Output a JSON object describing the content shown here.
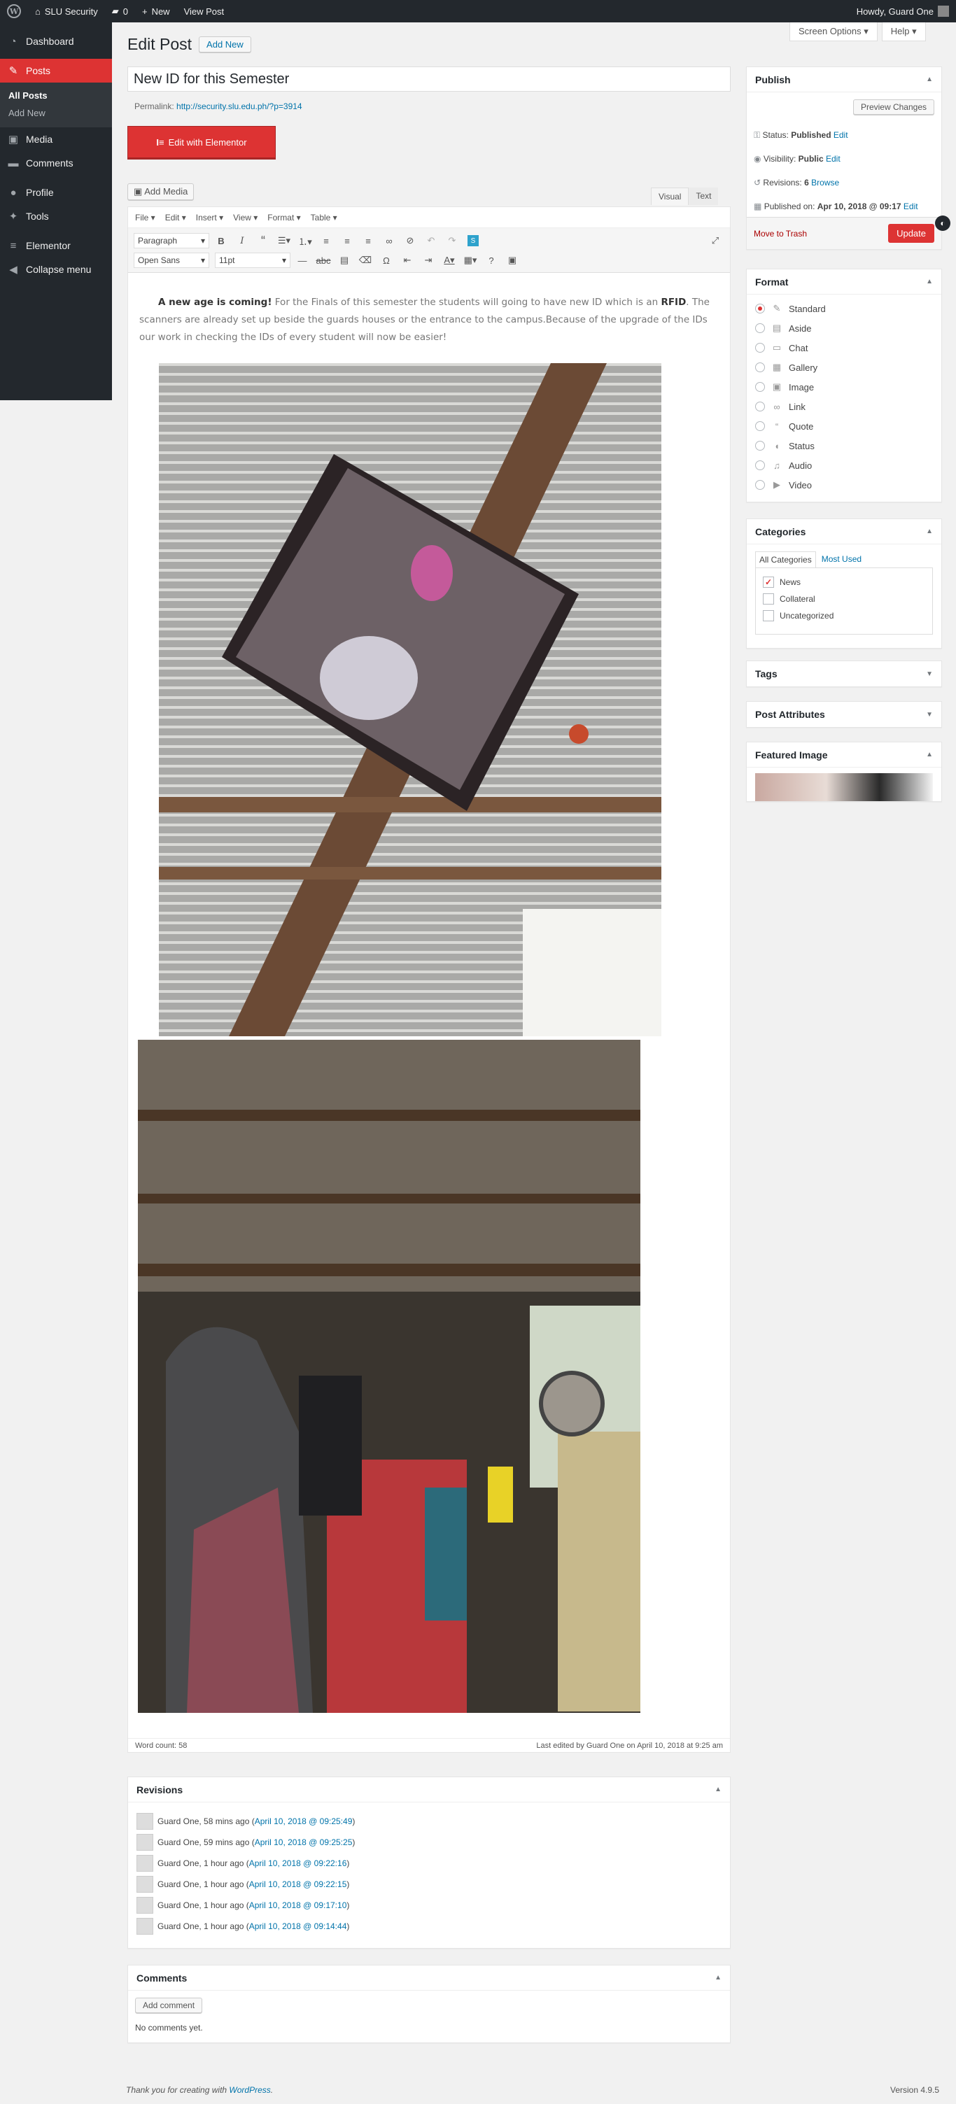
{
  "adminbar": {
    "site_name": "SLU Security",
    "comments_count": "0",
    "new_label": "New",
    "view_post": "View Post",
    "howdy": "Howdy, Guard One"
  },
  "sidebar": {
    "dashboard": "Dashboard",
    "posts": "Posts",
    "all_posts": "All Posts",
    "add_new": "Add New",
    "media": "Media",
    "comments": "Comments",
    "profile": "Profile",
    "tools": "Tools",
    "elementor": "Elementor",
    "collapse": "Collapse menu"
  },
  "header": {
    "title": "Edit Post",
    "add_new": "Add New",
    "screen_options": "Screen Options",
    "help": "Help"
  },
  "post": {
    "title_value": "New ID for this Semester",
    "permalink_label": "Permalink:",
    "permalink_url": "http://security.slu.edu.ph/?p=3914",
    "elementor_button": "Edit with Elementor",
    "add_media": "Add Media",
    "tab_visual": "Visual",
    "tab_text": "Text"
  },
  "editor": {
    "menus": [
      "File",
      "Edit",
      "Insert",
      "View",
      "Format",
      "Table"
    ],
    "paragraph_select": "Paragraph",
    "font_select": "Open Sans",
    "size_select": "11pt",
    "content_bold": "A new age is coming!",
    "content_text1": " For the Finals of this semester the students will going to have new ID which is an ",
    "content_rfid": "RFID",
    "content_text2": ".  The scanners are already set up beside the guards houses or the entrance to the campus.Because of the upgrade of the IDs our work in checking the IDs of every student will now be easier!",
    "word_count": "Word count: 58",
    "last_edited": "Last edited by Guard One on April 10, 2018 at 9:25 am"
  },
  "publish": {
    "heading": "Publish",
    "preview": "Preview Changes",
    "status_label": "Status:",
    "status_value": "Published",
    "visibility_label": "Visibility:",
    "visibility_value": "Public",
    "revisions_label": "Revisions:",
    "revisions_value": "6",
    "browse": "Browse",
    "published_label": "Published on:",
    "published_value": "Apr 10, 2018 @ 09:17",
    "edit": "Edit",
    "trash": "Move to Trash",
    "update": "Update"
  },
  "format": {
    "heading": "Format",
    "options": [
      {
        "label": "Standard",
        "icon": "pin-icon"
      },
      {
        "label": "Aside",
        "icon": "aside-icon"
      },
      {
        "label": "Chat",
        "icon": "chat-icon"
      },
      {
        "label": "Gallery",
        "icon": "gallery-icon"
      },
      {
        "label": "Image",
        "icon": "image-icon"
      },
      {
        "label": "Link",
        "icon": "link-icon"
      },
      {
        "label": "Quote",
        "icon": "quote-icon"
      },
      {
        "label": "Status",
        "icon": "status-icon"
      },
      {
        "label": "Audio",
        "icon": "audio-icon"
      },
      {
        "label": "Video",
        "icon": "video-icon"
      }
    ],
    "selected": "Standard"
  },
  "categories": {
    "heading": "Categories",
    "tab_all": "All Categories",
    "tab_used": "Most Used",
    "items": [
      {
        "label": "News",
        "checked": true
      },
      {
        "label": "Collateral",
        "checked": false
      },
      {
        "label": "Uncategorized",
        "checked": false
      }
    ]
  },
  "tags": {
    "heading": "Tags"
  },
  "attributes": {
    "heading": "Post Attributes"
  },
  "featured": {
    "heading": "Featured Image"
  },
  "revisions": {
    "heading": "Revisions",
    "items": [
      {
        "who": "Guard One, 58 mins ago (",
        "link": "April 10, 2018 @ 09:25:49",
        "end": ")"
      },
      {
        "who": "Guard One, 59 mins ago (",
        "link": "April 10, 2018 @ 09:25:25",
        "end": ")"
      },
      {
        "who": "Guard One, 1 hour ago (",
        "link": "April 10, 2018 @ 09:22:16",
        "end": ")"
      },
      {
        "who": "Guard One, 1 hour ago (",
        "link": "April 10, 2018 @ 09:22:15",
        "end": ")"
      },
      {
        "who": "Guard One, 1 hour ago (",
        "link": "April 10, 2018 @ 09:17:10",
        "end": ")"
      },
      {
        "who": "Guard One, 1 hour ago (",
        "link": "April 10, 2018 @ 09:14:44",
        "end": ")"
      }
    ]
  },
  "comments_box": {
    "heading": "Comments",
    "add": "Add comment",
    "none": "No comments yet."
  },
  "footer": {
    "thanks": "Thank you for creating with ",
    "wp": "WordPress",
    "thanks_end": ".",
    "version": "Version 4.9.5"
  },
  "colors": {
    "accent": "#dd3333",
    "admin_bg": "#23282d",
    "link": "#0073aa"
  }
}
